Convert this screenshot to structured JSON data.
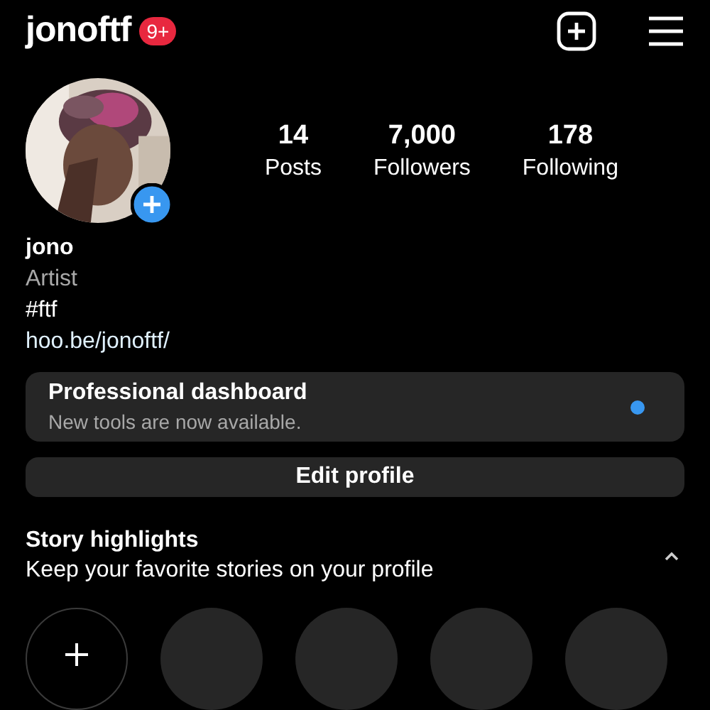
{
  "header": {
    "username": "jonoftf",
    "badge": "9+"
  },
  "profile": {
    "stats": [
      {
        "value": "14",
        "label": "Posts"
      },
      {
        "value": "7,000",
        "label": "Followers"
      },
      {
        "value": "178",
        "label": "Following"
      }
    ],
    "name": "jono",
    "category": "Artist",
    "bio": "#ftf",
    "link": "hoo.be/jonoftf/"
  },
  "dashboard": {
    "title": "Professional dashboard",
    "subtitle": "New tools are now available.",
    "unread": true
  },
  "edit_button": "Edit profile",
  "highlights": {
    "title": "Story highlights",
    "subtitle": "Keep your favorite stories on your profile",
    "expanded": true,
    "items": [
      {
        "kind": "new"
      },
      {
        "kind": "empty"
      },
      {
        "kind": "empty"
      },
      {
        "kind": "empty"
      },
      {
        "kind": "empty"
      }
    ]
  }
}
